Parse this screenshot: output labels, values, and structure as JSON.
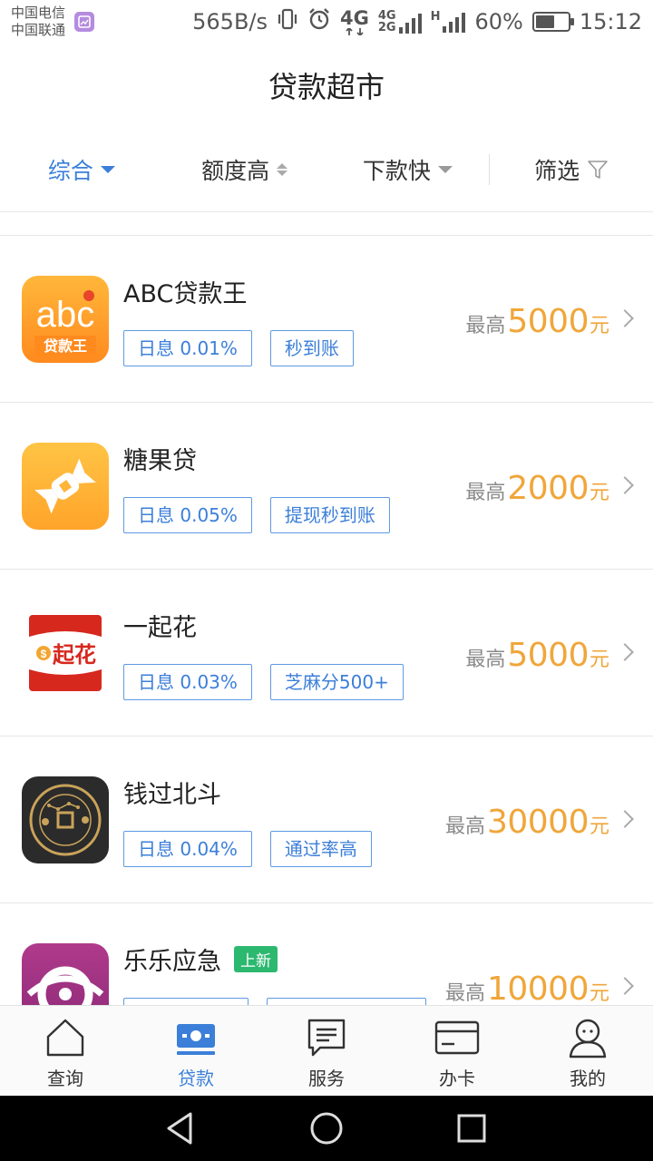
{
  "status_bar": {
    "carrier1": "中国电信",
    "carrier2": "中国联通",
    "net_speed": "565B/s",
    "net_4g": "4G",
    "net_4g2g_top": "4G",
    "net_4g2g_bottom": "2G",
    "net_h": "H",
    "battery": "60%",
    "battery_level": 0.6,
    "time": "15:12"
  },
  "header": {
    "title": "贷款超市"
  },
  "filters": [
    {
      "label": "综合"
    },
    {
      "label": "额度高"
    },
    {
      "label": "下款快"
    },
    {
      "label": "筛选"
    }
  ],
  "products": [
    {
      "name": "ABC贷款王",
      "tags": [
        "日息 0.01%",
        "秒到账"
      ],
      "amount_label": "最高",
      "amount": "5000",
      "unit": "元",
      "logo_text": "abc",
      "logo_subtext": "贷款王"
    },
    {
      "name": "糖果贷",
      "tags": [
        "日息 0.05%",
        "提现秒到账"
      ],
      "amount_label": "最高",
      "amount": "2000",
      "unit": "元"
    },
    {
      "name": "一起花",
      "tags": [
        "日息 0.03%",
        "芝麻分500+"
      ],
      "amount_label": "最高",
      "amount": "5000",
      "unit": "元",
      "logo_text": "起花"
    },
    {
      "name": "钱过北斗",
      "tags": [
        "日息 0.04%",
        "通过率高"
      ],
      "amount_label": "最高",
      "amount": "30000",
      "unit": "元"
    },
    {
      "name": "乐乐应急",
      "badge": "上新",
      "tags": [
        "",
        ""
      ],
      "amount_label": "最高",
      "amount": "10000",
      "unit": "元"
    }
  ],
  "bottom_nav": [
    {
      "label": "查询",
      "icon": "home-icon"
    },
    {
      "label": "贷款",
      "icon": "loan-icon",
      "active": true
    },
    {
      "label": "服务",
      "icon": "service-icon"
    },
    {
      "label": "办卡",
      "icon": "card-icon"
    },
    {
      "label": "我的",
      "icon": "profile-icon"
    }
  ],
  "colors": {
    "accent": "#3b7fd9",
    "amount": "#f0a63a",
    "new_badge": "#2db870"
  }
}
